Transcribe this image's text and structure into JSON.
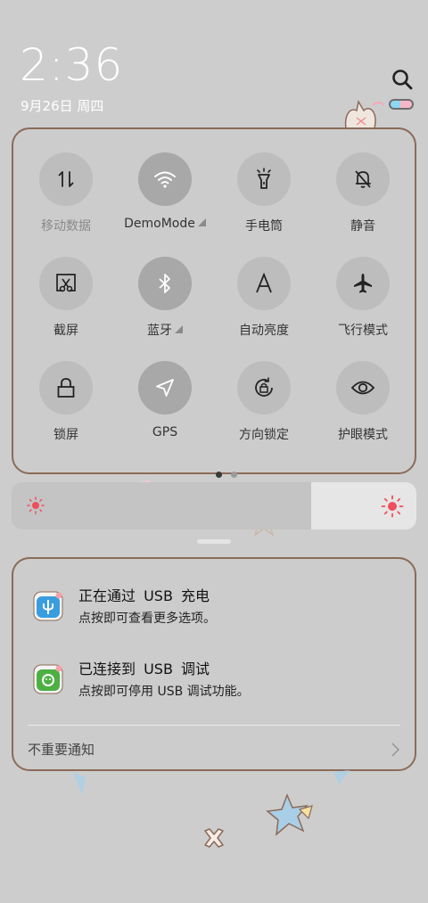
{
  "status": {
    "time": "2:36",
    "date": "9月26日 周四"
  },
  "quick_tiles": [
    {
      "label": "移动数据",
      "icon": "mobile-data-icon",
      "active": false
    },
    {
      "label": "DemoMode",
      "icon": "wifi-icon",
      "active": true
    },
    {
      "label": "手电筒",
      "icon": "flashlight-icon",
      "active": false
    },
    {
      "label": "静音",
      "icon": "silent-bell-icon",
      "active": false
    },
    {
      "label": "截屏",
      "icon": "screenshot-icon",
      "active": false
    },
    {
      "label": "蓝牙",
      "icon": "bluetooth-icon",
      "active": true
    },
    {
      "label": "自动亮度",
      "icon": "auto-brightness-icon",
      "active": false
    },
    {
      "label": "飞行模式",
      "icon": "airplane-icon",
      "active": false
    },
    {
      "label": "锁屏",
      "icon": "lock-icon",
      "active": false
    },
    {
      "label": "GPS",
      "icon": "gps-icon",
      "active": true
    },
    {
      "label": "方向锁定",
      "icon": "rotation-lock-icon",
      "active": false
    },
    {
      "label": "护眼模式",
      "icon": "eye-icon",
      "active": false
    }
  ],
  "pager": {
    "pages": 2,
    "current": 1
  },
  "brightness": {
    "level": 0.74
  },
  "notifications": [
    {
      "title": "正在通过 USB 充电",
      "subtitle": "点按即可查看更多选项。",
      "icon": "usb-charging-icon"
    },
    {
      "title": "已连接到 USB 调试",
      "subtitle": "点按即可停用 USB 调试功能。",
      "icon": "usb-debugging-icon"
    }
  ],
  "unimportant": {
    "label": "不重要通知"
  },
  "colors": {
    "panel_border": "#8b6b59",
    "active_tile": "#a8a8a8",
    "tile": "#bdbdbd",
    "sun": "#ef4e5e"
  }
}
